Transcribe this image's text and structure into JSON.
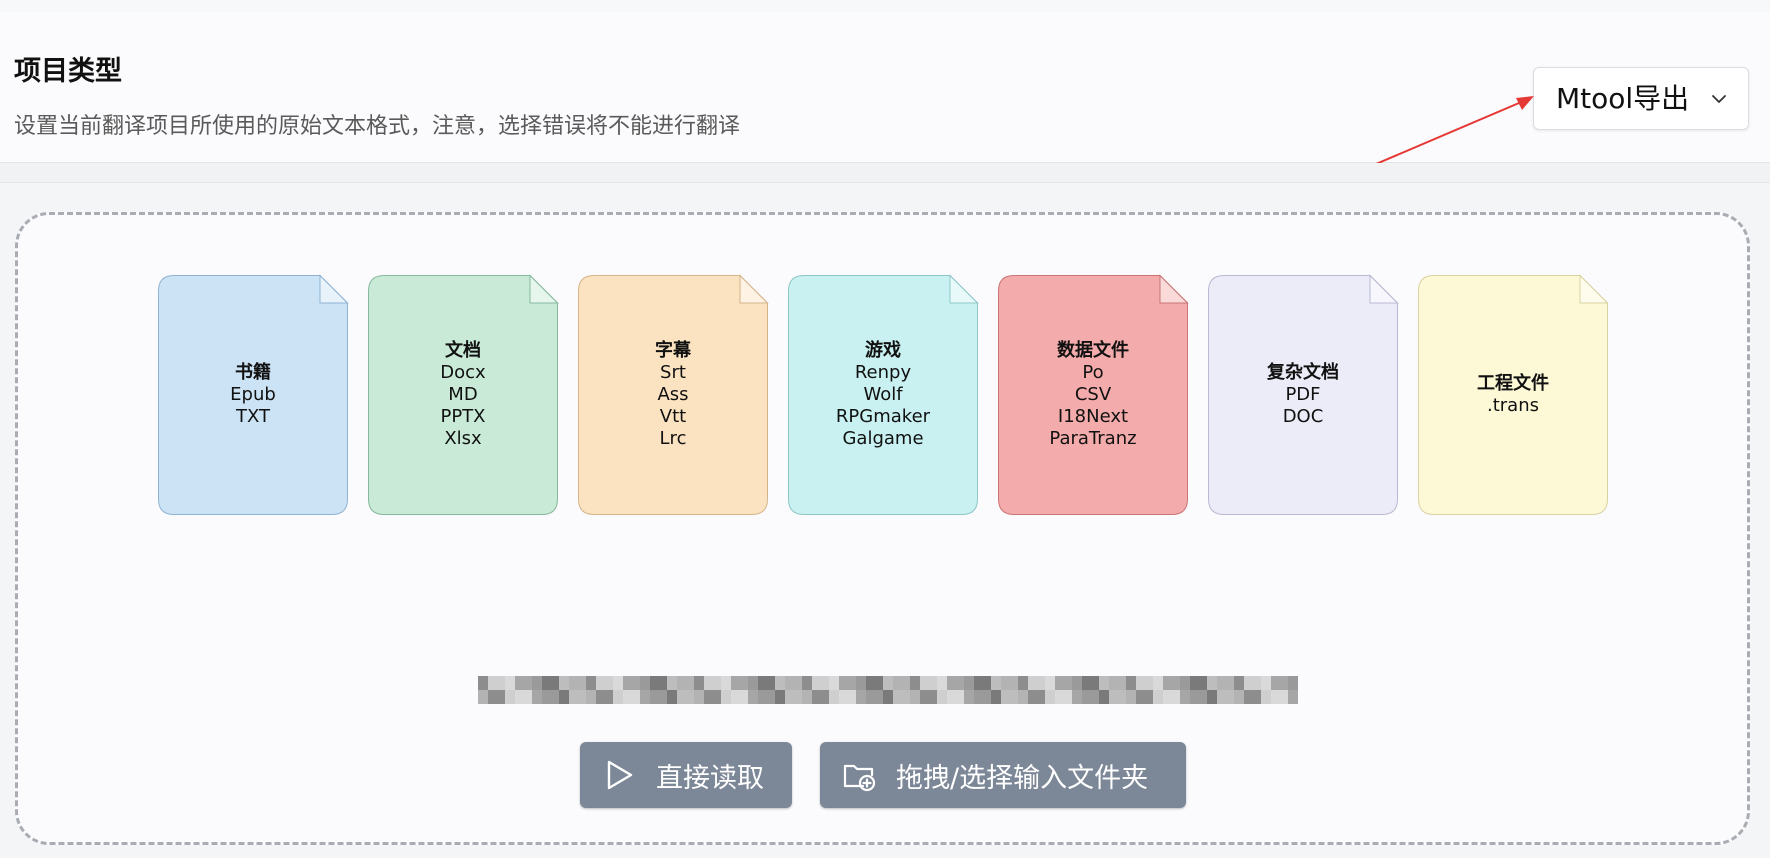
{
  "setting": {
    "title": "项目类型",
    "description": "设置当前翻译项目所使用的原始文本格式，注意，选择错误将不能进行翻译",
    "selected_type": "Mtool导出",
    "chevron_icon": "chevron-down-icon"
  },
  "annotation": {
    "arrow_color": "#e53935"
  },
  "file_types": [
    {
      "category": "书籍",
      "formats": [
        "Epub",
        "TXT"
      ],
      "color": "#cce3f5",
      "border": "#8fb3d3"
    },
    {
      "category": "文档",
      "formats": [
        "Docx",
        "MD",
        "PPTX",
        "Xlsx"
      ],
      "color": "#c8ead7",
      "border": "#86b89d"
    },
    {
      "category": "字幕",
      "formats": [
        "Srt",
        "Ass",
        "Vtt",
        "Lrc"
      ],
      "color": "#fbe3c1",
      "border": "#d4b48a"
    },
    {
      "category": "游戏",
      "formats": [
        "Renpy",
        "Wolf",
        "RPGmaker",
        "Galgame"
      ],
      "color": "#c9f1f1",
      "border": "#8ec6c6"
    },
    {
      "category": "数据文件",
      "formats": [
        "Po",
        "CSV",
        "I18Next",
        "ParaTranz"
      ],
      "color": "#f4abab",
      "border": "#c97575"
    },
    {
      "category": "复杂文档",
      "formats": [
        "PDF",
        "DOC"
      ],
      "color": "#ececf8",
      "border": "#b9b9d3"
    },
    {
      "category": "工程文件",
      "formats": [
        ".trans"
      ],
      "color": "#fdf9d6",
      "border": "#d9d2a2"
    }
  ],
  "actions": {
    "read_directly": {
      "label": "直接读取",
      "icon": "play-icon"
    },
    "select_folder": {
      "label": "拖拽/选择输入文件夹",
      "icon": "folder-add-icon"
    }
  },
  "colors": {
    "button_bg": "#7c8797",
    "drop_border": "#a9adb3"
  }
}
